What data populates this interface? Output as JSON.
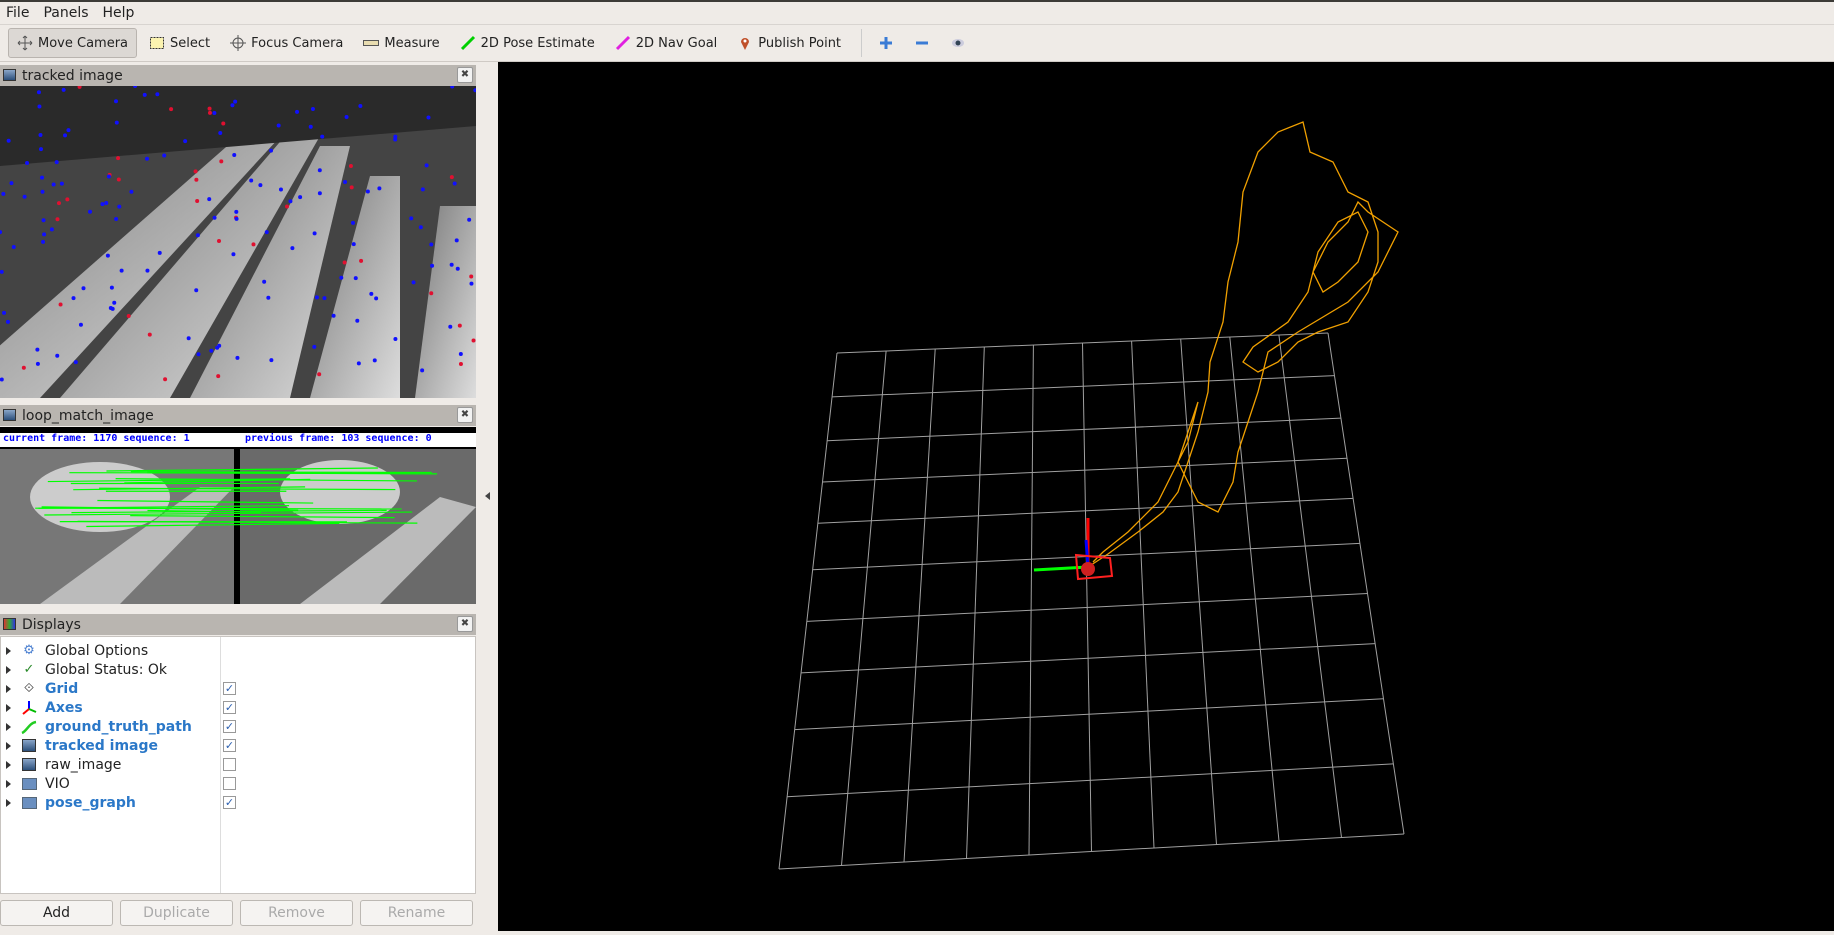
{
  "menu": [
    "File",
    "Panels",
    "Help"
  ],
  "toolbar": {
    "tools": [
      {
        "label": "Move Camera",
        "icon": "move-camera-icon",
        "active": true
      },
      {
        "label": "Select",
        "icon": "select-icon"
      },
      {
        "label": "Focus Camera",
        "icon": "focus-camera-icon"
      },
      {
        "label": "Measure",
        "icon": "measure-icon"
      },
      {
        "label": "2D Pose Estimate",
        "icon": "pose-estimate-icon",
        "color": "#00e000"
      },
      {
        "label": "2D Nav Goal",
        "icon": "nav-goal-icon",
        "color": "#e020e0"
      },
      {
        "label": "Publish Point",
        "icon": "publish-point-icon",
        "color": "#c0502a"
      }
    ],
    "extra_icons": [
      "plus-icon",
      "minus-icon",
      "eye-icon"
    ]
  },
  "panels": {
    "tracked": {
      "title": "tracked image"
    },
    "loop": {
      "title": "loop_match_image",
      "current": "current frame: 1170  sequence: 1",
      "previous": "previous frame: 103  sequence: 0"
    },
    "displays": {
      "title": "Displays"
    }
  },
  "displays": [
    {
      "label": "Global Options",
      "icon": "gear-icon",
      "bold": false,
      "checkbox": null
    },
    {
      "label": "Global Status: Ok",
      "icon": "check-icon",
      "bold": false,
      "checkbox": null
    },
    {
      "label": "Grid",
      "icon": "grid-icon",
      "bold": true,
      "checkbox": true
    },
    {
      "label": "Axes",
      "icon": "axes-icon",
      "bold": true,
      "checkbox": true
    },
    {
      "label": "ground_truth_path",
      "icon": "path-icon",
      "bold": true,
      "checkbox": true
    },
    {
      "label": "tracked image",
      "icon": "image-icon",
      "bold": true,
      "checkbox": true
    },
    {
      "label": "raw_image",
      "icon": "image-icon",
      "bold": false,
      "checkbox": false
    },
    {
      "label": "VIO",
      "icon": "folder-icon",
      "bold": false,
      "checkbox": false
    },
    {
      "label": "pose_graph",
      "icon": "folder-icon",
      "bold": true,
      "checkbox": true
    }
  ],
  "buttons": [
    {
      "label": "Add",
      "enabled": true
    },
    {
      "label": "Duplicate",
      "enabled": false
    },
    {
      "label": "Remove",
      "enabled": false
    },
    {
      "label": "Rename",
      "enabled": false
    }
  ],
  "colors": {
    "path": "#f0a000",
    "grid": "#a0a0a0",
    "viewport_bg": "#000000",
    "blue_label": "#2b78c8"
  }
}
